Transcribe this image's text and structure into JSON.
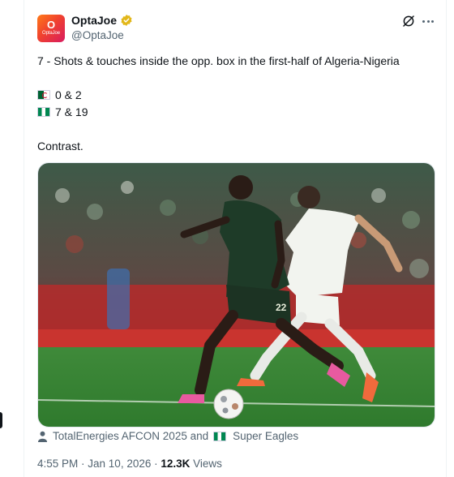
{
  "author": {
    "avatar_glyph": "O",
    "avatar_word": "OptaJoe",
    "display_name": "OptaJoe",
    "handle": "@OptaJoe",
    "verified_color": "#e2b719"
  },
  "tweet": {
    "line1": "7 - Shots & touches inside the opp. box in the first-half of Algeria-Nigeria",
    "algeria_flag": "algeria-flag-icon",
    "algeria_stats": "0 & 2",
    "nigeria_flag": "nigeria-flag-icon",
    "nigeria_stats": "7 & 19",
    "closing": "Contrast."
  },
  "media": {
    "alt": "Football match photo: Nigeria player in dark green kit dribbling past Algeria player in white kit",
    "away_number": "22"
  },
  "tags": {
    "prefix": "TotalEnergies AFCON 2025 and",
    "team": "Super Eagles"
  },
  "meta": {
    "time": "4:55 PM",
    "separator1": " · ",
    "date": "Jan 10, 2026",
    "separator2": " · ",
    "views_count": "12.3K",
    "views_label": " Views"
  },
  "colors": {
    "text_primary": "#0f1419",
    "text_secondary": "#536471",
    "brand_gradient_start": "#ff7a18",
    "brand_gradient_end": "#d81b60"
  }
}
